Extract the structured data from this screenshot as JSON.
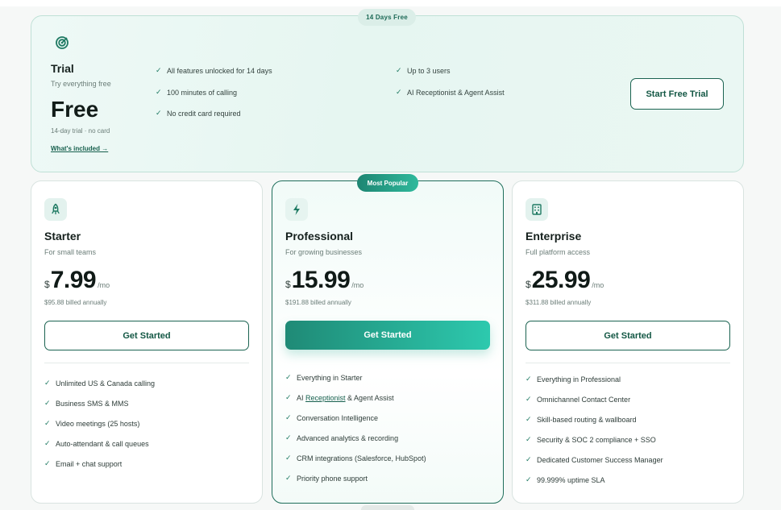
{
  "trial": {
    "badge": "14 Days Free",
    "icon": "target-icon",
    "name": "Trial",
    "tagline": "Try everything free",
    "price": "Free",
    "note": "14-day trial · no card",
    "link": "What's included →",
    "features_left": [
      "All features unlocked for 14 days",
      "100 minutes of calling",
      "No credit card required"
    ],
    "features_right": [
      "Up to 3 users",
      "AI Receptionist & Agent Assist"
    ],
    "cta": "Start Free Trial"
  },
  "popular_badge": "Most Popular",
  "plans": [
    {
      "icon": "rocket-icon",
      "name": "Starter",
      "tagline": "For small teams",
      "currency": "$",
      "price": "7.99",
      "per": "/mo",
      "billed": "$95.88 billed annually",
      "cta": "Get Started",
      "features": [
        "Unlimited US & Canada calling",
        "Business SMS & MMS",
        "Video meetings (25 hosts)",
        "Auto-attendant & call queues",
        "Email + chat support"
      ]
    },
    {
      "icon": "lightning-icon",
      "name": "Professional",
      "tagline": "For growing businesses",
      "currency": "$",
      "price": "15.99",
      "per": "/mo",
      "billed": "$191.88 billed annually",
      "cta": "Get Started",
      "features": [
        "Everything in Starter",
        "AI Receptionist & Agent Assist",
        "Conversation Intelligence",
        "Advanced analytics & recording",
        "CRM integrations (Salesforce, HubSpot)",
        "Priority phone support"
      ],
      "feature_1_parts": {
        "pre": "AI ",
        "link": "Receptionist",
        "post": " & Agent Assist"
      }
    },
    {
      "icon": "building-icon",
      "name": "Enterprise",
      "tagline": "Full platform access",
      "currency": "$",
      "price": "25.99",
      "per": "/mo",
      "billed": "$311.88 billed annually",
      "cta": "Get Started",
      "features": [
        "Everything in Professional",
        "Omnichannel Contact Center",
        "Skill-based routing & wallboard",
        "Security & SOC 2 compliance + SSO",
        "Dedicated Customer Success Manager",
        "99.999% uptime SLA"
      ]
    }
  ],
  "colors": {
    "accent": "#1b6351",
    "accent_gradient_start": "#1f8a76",
    "accent_gradient_end": "#2dc9ae",
    "card_border": "#d9e3e0"
  }
}
